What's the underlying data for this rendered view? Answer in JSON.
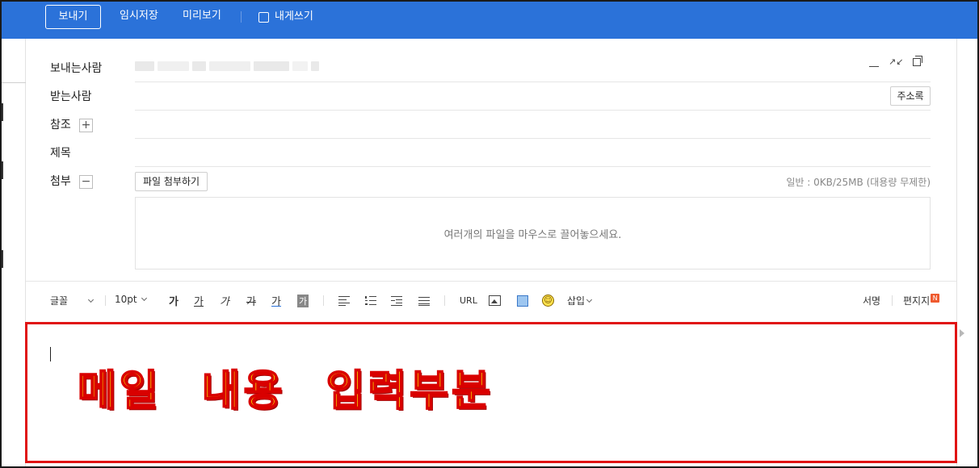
{
  "toolbar": {
    "send_label": "보내기",
    "draft_label": "임시저장",
    "preview_label": "미리보기",
    "self_label": "내게쓰기"
  },
  "form": {
    "sender_label": "보내는사람",
    "recipient_label": "받는사람",
    "address_book_label": "주소록",
    "cc_label": "참조",
    "subject_label": "제목",
    "attach_label": "첨부",
    "attach_button_label": "파일 첨부하기",
    "quota_text": "일반 : 0KB/25MB (대용량 무제한)",
    "dropzone_text": "여러개의 파일을 마우스로 끌어놓으세요."
  },
  "editor_toolbar": {
    "font_label": "글꼴",
    "size_label": "10pt",
    "bold_glyph": "가",
    "underline_glyph": "가",
    "italic_glyph": "가",
    "strike_glyph": "가",
    "color_glyph": "가",
    "bg_glyph": "가",
    "url_label": "URL",
    "insert_label": "삽입",
    "signature_label": "서명",
    "letter_label": "편지지",
    "new_badge": "N",
    "icons": [
      "align-left-icon",
      "numbered-list-icon",
      "indent-icon",
      "horizontal-rule-icon",
      "image-icon",
      "table-icon",
      "emoticon-icon"
    ]
  },
  "content": {
    "overlay_text": "메일 내용 입력부분",
    "highlight_color": "#e01414"
  },
  "colors": {
    "topbar": "#2b72d9",
    "overlay_fill": "#ffff00",
    "overlay_stroke": "#d90000"
  }
}
